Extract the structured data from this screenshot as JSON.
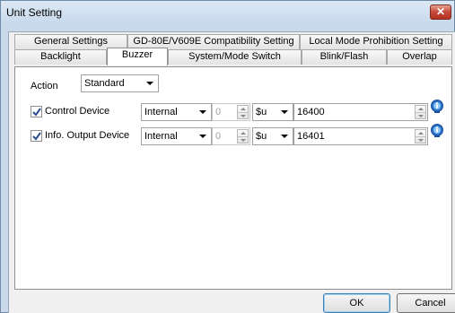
{
  "window": {
    "title": "Unit Setting",
    "close_glyph": "✕"
  },
  "tabs": {
    "row1": [
      "General Settings",
      "GD-80E/V609E Compatibility Setting",
      "Local Mode Prohibition Setting"
    ],
    "row2": [
      "Backlight",
      "Buzzer",
      "System/Mode Switch",
      "Blink/Flash",
      "Overlap"
    ],
    "active": "Buzzer"
  },
  "form": {
    "action_label": "Action",
    "action_value": "Standard",
    "rows": [
      {
        "label": "Control Device",
        "checked": true,
        "memory": "Internal",
        "port": "0",
        "device_type": "$u",
        "address": "16400"
      },
      {
        "label": "Info. Output Device",
        "checked": true,
        "memory": "Internal",
        "port": "0",
        "device_type": "$u",
        "address": "16401"
      }
    ]
  },
  "buttons": {
    "ok": "OK",
    "cancel": "Cancel"
  },
  "colors": {
    "info_icon": "#2a6fc9",
    "close_button": "#c4483a",
    "check_mark": "#2a4d8f"
  }
}
